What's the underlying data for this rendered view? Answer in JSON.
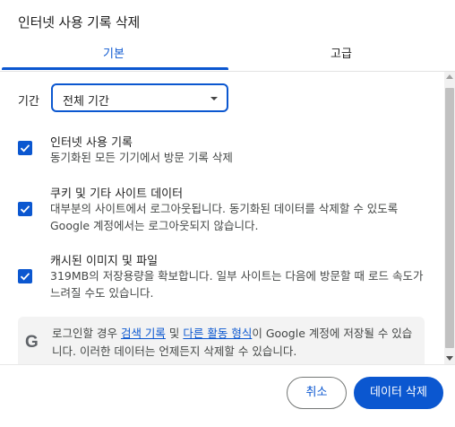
{
  "dialog": {
    "title": "인터넷 사용 기록 삭제"
  },
  "tabs": [
    {
      "label": "기본",
      "selected": true
    },
    {
      "label": "고급",
      "selected": false
    }
  ],
  "time_range": {
    "label": "기간",
    "selected_value": "전체 기간"
  },
  "options": [
    {
      "title": "인터넷 사용 기록",
      "description": "동기화된 모든 기기에서 방문 기록 삭제",
      "checked": true
    },
    {
      "title": "쿠키 및 기타 사이트 데이터",
      "description": "대부분의 사이트에서 로그아웃됩니다. 동기화된 데이터를 삭제할 수 있도록 Google 계정에서는 로그아웃되지 않습니다.",
      "checked": true
    },
    {
      "title": "캐시된 이미지 및 파일",
      "description": "319MB의 저장용량을 확보합니다. 일부 사이트는 다음에 방문할 때 로드 속도가 느려질 수도 있습니다.",
      "checked": true
    }
  ],
  "info": {
    "prefix": "로그인할 경우 ",
    "link1": "검색 기록",
    "middle": " 및 ",
    "link2": "다른 활동 형식",
    "suffix": "이 Google 계정에 저장될 수 있습니다. 이러한 데이터는 언제든지 삭제할 수 있습니다."
  },
  "buttons": {
    "cancel": "취소",
    "delete": "데이터 삭제"
  },
  "colors": {
    "accent": "#0b57d0",
    "text": "#1f1f1f",
    "secondary_text": "#444746"
  }
}
